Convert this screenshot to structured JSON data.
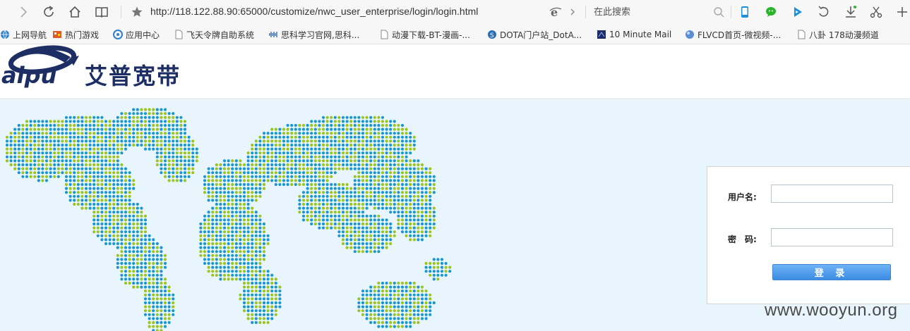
{
  "toolbar": {
    "url": "http://118.122.88.90:65000/customize/nwc_user_enterprise/login/login.html",
    "search_placeholder": "在此搜索"
  },
  "bookmarks": [
    {
      "label": "上网导航",
      "icon": "globe-icon",
      "color": "#2d7fd3"
    },
    {
      "label": "热门游戏",
      "icon": "game-icon",
      "color": "#e05a2b"
    },
    {
      "label": "应用中心",
      "icon": "app-center-icon",
      "color": "#2d7fd3"
    },
    {
      "label": "飞天令牌自助系统",
      "icon": "page-icon",
      "color": "#888888"
    },
    {
      "label": "思科学习官网,思科...",
      "icon": "cisco-icon",
      "color": "#1b5aa8"
    },
    {
      "label": "动漫下载-BT-漫画-...",
      "icon": "page-icon",
      "color": "#888888"
    },
    {
      "label": "DOTA门户站_DotA...",
      "icon": "dota-icon",
      "color": "#2a6fb5"
    },
    {
      "label": "10 Minute Mail",
      "icon": "mail-icon",
      "color": "#1e2b6b"
    },
    {
      "label": "FLVCD首页-微视频-...",
      "icon": "flvcd-icon",
      "color": "#5a8fd8"
    },
    {
      "label": "八卦 178动漫频道",
      "icon": "page-icon",
      "color": "#888888"
    }
  ],
  "header": {
    "logo_text": "aipu",
    "brand_name": "艾普宽带"
  },
  "login": {
    "username_label": "用户名:",
    "password_label": "密　码:",
    "username_value": "",
    "password_value": "",
    "submit_label": "登 录"
  },
  "watermark": "www.wooyun.org",
  "colors": {
    "map_green": "#9cc420",
    "map_blue": "#1a97d0",
    "brand_navy": "#1c2e63",
    "page_bg": "#e8f5fc",
    "button_blue": "#4a98e8"
  }
}
